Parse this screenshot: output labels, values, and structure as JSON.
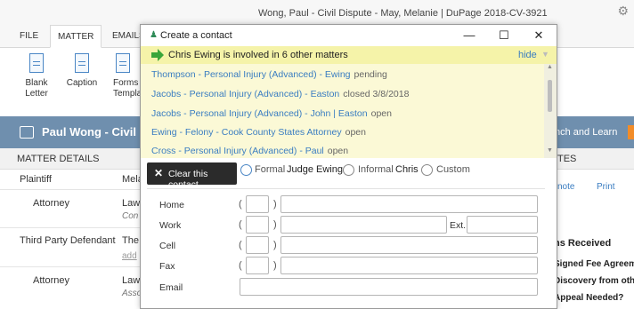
{
  "window": {
    "title": "Wong, Paul - Civil Dispute - May, Melanie | DuPage 2018-CV-3921",
    "settings_icon": "gear-icon"
  },
  "ribbon": {
    "tabs": [
      "FILE",
      "MATTER",
      "EMAILS"
    ],
    "active_tab": "MATTER",
    "buttons": [
      {
        "label_line1": "Blank",
        "label_line2": "Letter"
      },
      {
        "label_line1": "Caption",
        "label_line2": ""
      },
      {
        "label_line1": "Forms",
        "label_line2": "Templa"
      }
    ]
  },
  "contact_bar": {
    "name": "Paul Wong - Civil D",
    "right_link": "nch and Learn",
    "accent_color": "#f28c28"
  },
  "matter_details": {
    "heading": "MATTER DETAILS",
    "rows": [
      {
        "role": "Plaintiff",
        "value": "Mela"
      },
      {
        "role": "Attorney",
        "value": "Law",
        "sub": "Con"
      },
      {
        "role": "Third Party Defendant",
        "value": "The",
        "link": "add"
      },
      {
        "role": "Attorney",
        "value": "Law",
        "sub": "Asso"
      }
    ]
  },
  "right_panel": {
    "heading": "TES",
    "links": [
      "note",
      "Print"
    ],
    "section_title": "ns Received",
    "items": [
      "Signed Fee Agreem",
      "Discovery from oth",
      "Appeal Needed?"
    ]
  },
  "dialog": {
    "title": "Create a contact",
    "controls": {
      "minimize": "—",
      "maximize": "☐",
      "close": "✕"
    },
    "notice": {
      "text": "Chris Ewing is involved in 6 other matters",
      "hide_label": "hide",
      "bg_color": "#f5f3a9"
    },
    "matters": [
      {
        "name": "Thompson - Personal Injury (Advanced) - Ewing",
        "status": "pending"
      },
      {
        "name": "Jacobs - Personal Injury (Advanced) - Easton",
        "status": "closed 3/8/2018"
      },
      {
        "name": "Jacobs - Personal Injury (Advanced) - John | Easton",
        "status": "open"
      },
      {
        "name": "Ewing - Felony - Cook County States Attorney",
        "status": "open"
      },
      {
        "name": "Cross - Personal Injury (Advanced) - Paul",
        "status": "open"
      }
    ],
    "clear_button": "Clear this contact",
    "salutation": {
      "formal_label": "Formal",
      "formal_value": "Judge Ewing",
      "informal_label": "Informal",
      "informal_value": "Chris",
      "custom_label": "Custom",
      "selected": "Formal"
    },
    "phone_fields": [
      {
        "label": "Home",
        "area": "",
        "number": ""
      },
      {
        "label": "Work",
        "area": "",
        "number": "",
        "ext_label": "Ext.",
        "ext": ""
      },
      {
        "label": "Cell",
        "area": "",
        "number": ""
      },
      {
        "label": "Fax",
        "area": "",
        "number": ""
      }
    ],
    "email_field": {
      "label": "Email",
      "value": ""
    },
    "paren_open": "(",
    "paren_close": ")"
  }
}
